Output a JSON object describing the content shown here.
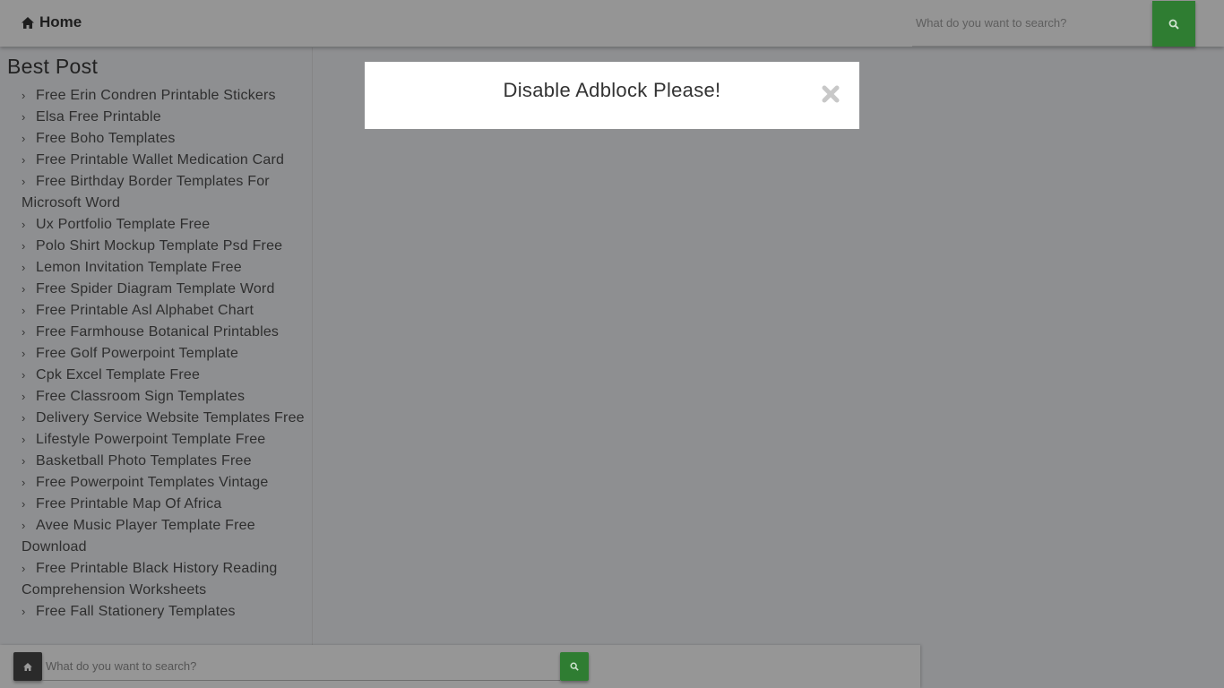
{
  "header": {
    "home_label": "Home",
    "home_icon": "home-icon",
    "search": {
      "placeholder": "What do you want to search?",
      "value": "",
      "button_icon": "search-icon"
    }
  },
  "sidebar": {
    "title": "Best Post",
    "items": [
      {
        "label": "Free Erin Condren Printable Stickers"
      },
      {
        "label": "Elsa Free Printable"
      },
      {
        "label": "Free Boho Templates"
      },
      {
        "label": "Free Printable Wallet Medication Card"
      },
      {
        "label": "Free Birthday Border Templates For Microsoft Word"
      },
      {
        "label": "Ux Portfolio Template Free"
      },
      {
        "label": "Polo Shirt Mockup Template Psd Free"
      },
      {
        "label": "Lemon Invitation Template Free"
      },
      {
        "label": "Free Spider Diagram Template Word"
      },
      {
        "label": "Free Printable Asl Alphabet Chart"
      },
      {
        "label": "Free Farmhouse Botanical Printables"
      },
      {
        "label": "Free Golf Powerpoint Template"
      },
      {
        "label": "Cpk Excel Template Free"
      },
      {
        "label": "Free Classroom Sign Templates"
      },
      {
        "label": "Delivery Service Website Templates Free"
      },
      {
        "label": "Lifestyle Powerpoint Template Free"
      },
      {
        "label": "Basketball Photo Templates Free"
      },
      {
        "label": "Free Powerpoint Templates Vintage"
      },
      {
        "label": "Free Printable Map Of Africa"
      },
      {
        "label": "Avee Music Player Template Free Download"
      },
      {
        "label": "Free Printable Black History Reading Comprehension Worksheets"
      },
      {
        "label": "Free Fall Stationery Templates"
      }
    ],
    "item_icon": "chevron-right-icon"
  },
  "modal": {
    "title": "Disable Adblock Please!",
    "close_icon": "close-icon"
  },
  "bottom_bar": {
    "home_icon": "home-icon",
    "search": {
      "placeholder": "What do you want to search?",
      "value": "",
      "button_icon": "search-icon"
    }
  },
  "colors": {
    "accent_green": "#2f7d32",
    "overlay": "#8e8f91",
    "modal_bg": "#ffffff",
    "close_icon": "#c8c8c8"
  }
}
